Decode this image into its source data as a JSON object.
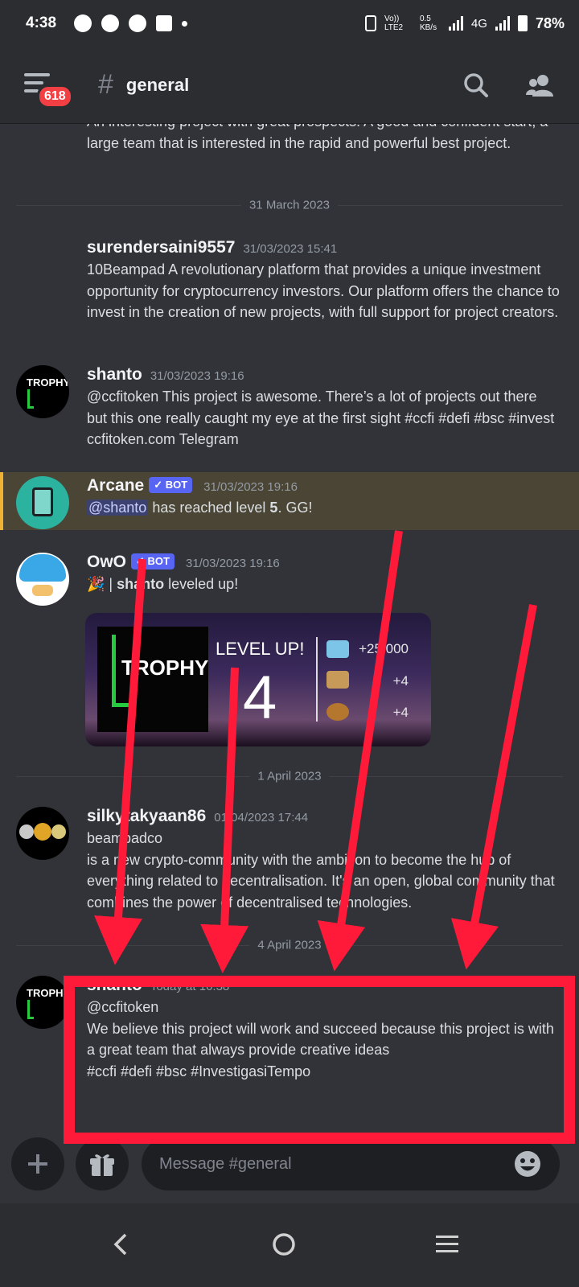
{
  "status_bar": {
    "time": "4:38",
    "network": "0.5\nKB/s",
    "lte": "Vo)) LTE2",
    "signal": "4G",
    "battery": "78%"
  },
  "header": {
    "notification_badge": "618",
    "channel_title": "general"
  },
  "messages": {
    "m0": {
      "text": "An interesting project with great prospects! A good and confident start, a large team that is interested in the rapid and powerful best project."
    },
    "divider1": "31 March 2023",
    "m1": {
      "username": "surendersaini9557",
      "timestamp": "31/03/2023 15:41",
      "text": "10Beampad A revolutionary platform that provides a unique investment opportunity for cryptocurrency investors. Our platform offers the chance to invest in the creation of new projects, with full support for project creators."
    },
    "m2": {
      "username": "shanto",
      "timestamp": "31/03/2023 19:16",
      "avatar_text": "TROPHY",
      "text": "@ccfitoken This project is awesome. There’s a lot of projects out there but this one really caught my eye at the first sight #ccfi  #defi #bsc #invest ccfitoken.com Telegram"
    },
    "m3": {
      "username": "Arcane",
      "bot_label": "BOT",
      "timestamp": "31/03/2023 19:16",
      "mention": "@shanto",
      "text_mid": " has reached level ",
      "level": "5",
      "text_end": ". GG!"
    },
    "m4": {
      "username": "OwO",
      "bot_label": "BOT",
      "timestamp": "31/03/2023 19:16",
      "emoji": "🎉",
      "separator": " | ",
      "who": "shanto",
      "text": " leveled up!",
      "card": {
        "trophy_text": "TROPHY",
        "level_up": "LEVEL UP!",
        "level": "4",
        "reward1": "+25,000",
        "reward2": "+4",
        "reward3": "+4"
      }
    },
    "divider2": "1 April 2023",
    "m5": {
      "username": "silkytakyaan86",
      "timestamp": "01/04/2023 17:44",
      "line1": "beampadco",
      "text": " is a new crypto-community with the ambition to become the hub of everything related to decentralisation. It's an open, global community that combines the power of decentralised technologies."
    },
    "divider3": "4 April 2023",
    "m6": {
      "username": "shanto",
      "timestamp": "Today at 16:38",
      "avatar_text": "TROPHY",
      "line1": "@ccfitoken",
      "line2": "We believe this project will work and succeed because this project is with a great team that always provide creative ideas",
      "line3": "#ccfi #defi #bsc #InvestigasiTempo"
    }
  },
  "composer": {
    "placeholder": "Message #general"
  },
  "colors": {
    "background": "#313338",
    "header": "#2b2d31",
    "annotation_red": "#ff1a3a",
    "bot_badge": "#5865f2",
    "highlight_bar": "#f0b232"
  }
}
